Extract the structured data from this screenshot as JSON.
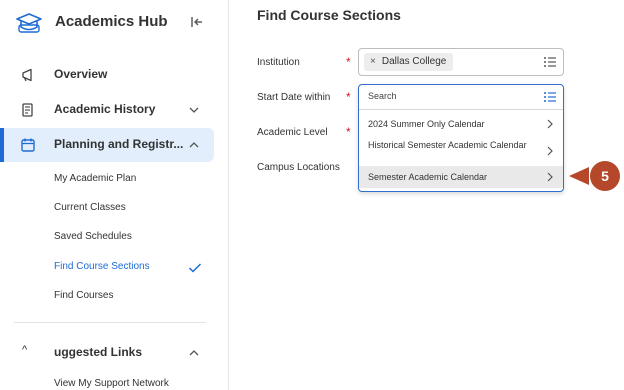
{
  "sidebar": {
    "title": "Academics Hub",
    "items": [
      {
        "label": "Overview",
        "icon": "megaphone-icon"
      },
      {
        "label": "Academic History",
        "icon": "document-history-icon"
      },
      {
        "label": "Planning and Registr...",
        "icon": "calendar-icon"
      }
    ],
    "sub_items": [
      {
        "label": "My Academic Plan"
      },
      {
        "label": "Current Classes"
      },
      {
        "label": "Saved Schedules"
      },
      {
        "label": "Find Course Sections"
      },
      {
        "label": "Find Courses"
      }
    ],
    "suggested": {
      "label": "uggested Links",
      "caret": "^"
    },
    "support_link": "View My Support Network"
  },
  "main": {
    "title": "Find Course Sections",
    "fields": {
      "institution_label": "Institution",
      "start_date_label": "Start Date within",
      "academic_level_label": "Academic Level",
      "campus_label": "Campus Locations",
      "required_mark": "*"
    },
    "institution_chip": "Dallas College",
    "chip_remove": "×",
    "dropdown": {
      "search_placeholder": "Search",
      "options": [
        {
          "label": "2024 Summer Only Calendar"
        },
        {
          "label": "Historical Semester Academic Calendar"
        },
        {
          "label": "Semester Academic Calendar"
        }
      ]
    }
  },
  "callout": {
    "number": "5",
    "color": "#b5472b"
  },
  "colors": {
    "accent": "#1f6bd6",
    "required": "#c8211f",
    "active_bg": "#e2eefb"
  }
}
